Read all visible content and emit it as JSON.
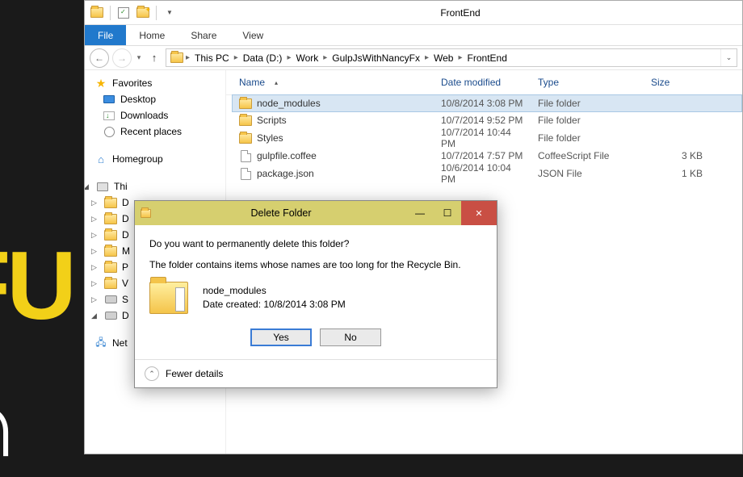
{
  "window": {
    "title": "FrontEnd"
  },
  "ribbon": {
    "file": "File",
    "home": "Home",
    "share": "Share",
    "view": "View"
  },
  "breadcrumb": [
    "This PC",
    "Data (D:)",
    "Work",
    "GulpJsWithNancyFx",
    "Web",
    "FrontEnd"
  ],
  "sidebar": {
    "favorites": {
      "label": "Favorites",
      "items": [
        {
          "label": "Desktop"
        },
        {
          "label": "Downloads"
        },
        {
          "label": "Recent places"
        }
      ]
    },
    "homegroup": {
      "label": "Homegroup"
    },
    "thispc": {
      "label": "Thi",
      "items": [
        {
          "label": "D"
        },
        {
          "label": "D"
        },
        {
          "label": "D"
        },
        {
          "label": "M"
        },
        {
          "label": "P"
        },
        {
          "label": "V"
        },
        {
          "label": "S"
        },
        {
          "label": "D"
        }
      ]
    },
    "network": {
      "label": "Net"
    }
  },
  "columns": {
    "name": "Name",
    "date": "Date modified",
    "type": "Type",
    "size": "Size"
  },
  "files": [
    {
      "name": "node_modules",
      "date": "10/8/2014 3:08 PM",
      "type": "File folder",
      "size": "",
      "icon": "folder",
      "selected": true
    },
    {
      "name": "Scripts",
      "date": "10/7/2014 9:52 PM",
      "type": "File folder",
      "size": "",
      "icon": "folder"
    },
    {
      "name": "Styles",
      "date": "10/7/2014 10:44 PM",
      "type": "File folder",
      "size": "",
      "icon": "folder"
    },
    {
      "name": "gulpfile.coffee",
      "date": "10/7/2014 7:57 PM",
      "type": "CoffeeScript File",
      "size": "3 KB",
      "icon": "file"
    },
    {
      "name": "package.json",
      "date": "10/6/2014 10:04 PM",
      "type": "JSON File",
      "size": "1 KB",
      "icon": "file"
    }
  ],
  "dialog": {
    "title": "Delete Folder",
    "message": "Do you want to permanently delete this folder?",
    "submessage": "The folder contains items whose names are too long for the Recycle Bin.",
    "item_name": "node_modules",
    "item_date_label": "Date created: 10/8/2014 3:08 PM",
    "yes": "Yes",
    "no": "No",
    "fewer": "Fewer details"
  }
}
